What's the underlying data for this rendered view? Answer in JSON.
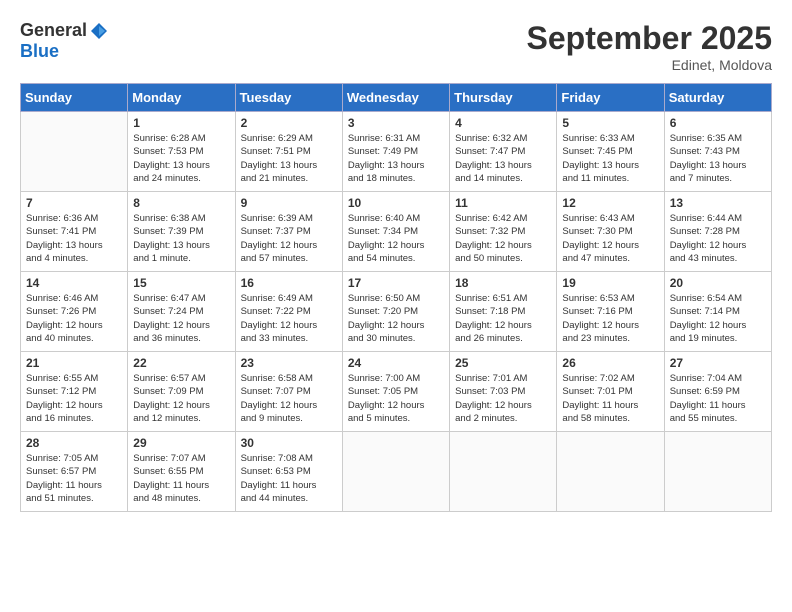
{
  "header": {
    "logo_general": "General",
    "logo_blue": "Blue",
    "month_title": "September 2025",
    "subtitle": "Edinet, Moldova"
  },
  "weekdays": [
    "Sunday",
    "Monday",
    "Tuesday",
    "Wednesday",
    "Thursday",
    "Friday",
    "Saturday"
  ],
  "weeks": [
    [
      {
        "day": "",
        "info": ""
      },
      {
        "day": "1",
        "info": "Sunrise: 6:28 AM\nSunset: 7:53 PM\nDaylight: 13 hours\nand 24 minutes."
      },
      {
        "day": "2",
        "info": "Sunrise: 6:29 AM\nSunset: 7:51 PM\nDaylight: 13 hours\nand 21 minutes."
      },
      {
        "day": "3",
        "info": "Sunrise: 6:31 AM\nSunset: 7:49 PM\nDaylight: 13 hours\nand 18 minutes."
      },
      {
        "day": "4",
        "info": "Sunrise: 6:32 AM\nSunset: 7:47 PM\nDaylight: 13 hours\nand 14 minutes."
      },
      {
        "day": "5",
        "info": "Sunrise: 6:33 AM\nSunset: 7:45 PM\nDaylight: 13 hours\nand 11 minutes."
      },
      {
        "day": "6",
        "info": "Sunrise: 6:35 AM\nSunset: 7:43 PM\nDaylight: 13 hours\nand 7 minutes."
      }
    ],
    [
      {
        "day": "7",
        "info": "Sunrise: 6:36 AM\nSunset: 7:41 PM\nDaylight: 13 hours\nand 4 minutes."
      },
      {
        "day": "8",
        "info": "Sunrise: 6:38 AM\nSunset: 7:39 PM\nDaylight: 13 hours\nand 1 minute."
      },
      {
        "day": "9",
        "info": "Sunrise: 6:39 AM\nSunset: 7:37 PM\nDaylight: 12 hours\nand 57 minutes."
      },
      {
        "day": "10",
        "info": "Sunrise: 6:40 AM\nSunset: 7:34 PM\nDaylight: 12 hours\nand 54 minutes."
      },
      {
        "day": "11",
        "info": "Sunrise: 6:42 AM\nSunset: 7:32 PM\nDaylight: 12 hours\nand 50 minutes."
      },
      {
        "day": "12",
        "info": "Sunrise: 6:43 AM\nSunset: 7:30 PM\nDaylight: 12 hours\nand 47 minutes."
      },
      {
        "day": "13",
        "info": "Sunrise: 6:44 AM\nSunset: 7:28 PM\nDaylight: 12 hours\nand 43 minutes."
      }
    ],
    [
      {
        "day": "14",
        "info": "Sunrise: 6:46 AM\nSunset: 7:26 PM\nDaylight: 12 hours\nand 40 minutes."
      },
      {
        "day": "15",
        "info": "Sunrise: 6:47 AM\nSunset: 7:24 PM\nDaylight: 12 hours\nand 36 minutes."
      },
      {
        "day": "16",
        "info": "Sunrise: 6:49 AM\nSunset: 7:22 PM\nDaylight: 12 hours\nand 33 minutes."
      },
      {
        "day": "17",
        "info": "Sunrise: 6:50 AM\nSunset: 7:20 PM\nDaylight: 12 hours\nand 30 minutes."
      },
      {
        "day": "18",
        "info": "Sunrise: 6:51 AM\nSunset: 7:18 PM\nDaylight: 12 hours\nand 26 minutes."
      },
      {
        "day": "19",
        "info": "Sunrise: 6:53 AM\nSunset: 7:16 PM\nDaylight: 12 hours\nand 23 minutes."
      },
      {
        "day": "20",
        "info": "Sunrise: 6:54 AM\nSunset: 7:14 PM\nDaylight: 12 hours\nand 19 minutes."
      }
    ],
    [
      {
        "day": "21",
        "info": "Sunrise: 6:55 AM\nSunset: 7:12 PM\nDaylight: 12 hours\nand 16 minutes."
      },
      {
        "day": "22",
        "info": "Sunrise: 6:57 AM\nSunset: 7:09 PM\nDaylight: 12 hours\nand 12 minutes."
      },
      {
        "day": "23",
        "info": "Sunrise: 6:58 AM\nSunset: 7:07 PM\nDaylight: 12 hours\nand 9 minutes."
      },
      {
        "day": "24",
        "info": "Sunrise: 7:00 AM\nSunset: 7:05 PM\nDaylight: 12 hours\nand 5 minutes."
      },
      {
        "day": "25",
        "info": "Sunrise: 7:01 AM\nSunset: 7:03 PM\nDaylight: 12 hours\nand 2 minutes."
      },
      {
        "day": "26",
        "info": "Sunrise: 7:02 AM\nSunset: 7:01 PM\nDaylight: 11 hours\nand 58 minutes."
      },
      {
        "day": "27",
        "info": "Sunrise: 7:04 AM\nSunset: 6:59 PM\nDaylight: 11 hours\nand 55 minutes."
      }
    ],
    [
      {
        "day": "28",
        "info": "Sunrise: 7:05 AM\nSunset: 6:57 PM\nDaylight: 11 hours\nand 51 minutes."
      },
      {
        "day": "29",
        "info": "Sunrise: 7:07 AM\nSunset: 6:55 PM\nDaylight: 11 hours\nand 48 minutes."
      },
      {
        "day": "30",
        "info": "Sunrise: 7:08 AM\nSunset: 6:53 PM\nDaylight: 11 hours\nand 44 minutes."
      },
      {
        "day": "",
        "info": ""
      },
      {
        "day": "",
        "info": ""
      },
      {
        "day": "",
        "info": ""
      },
      {
        "day": "",
        "info": ""
      }
    ]
  ]
}
